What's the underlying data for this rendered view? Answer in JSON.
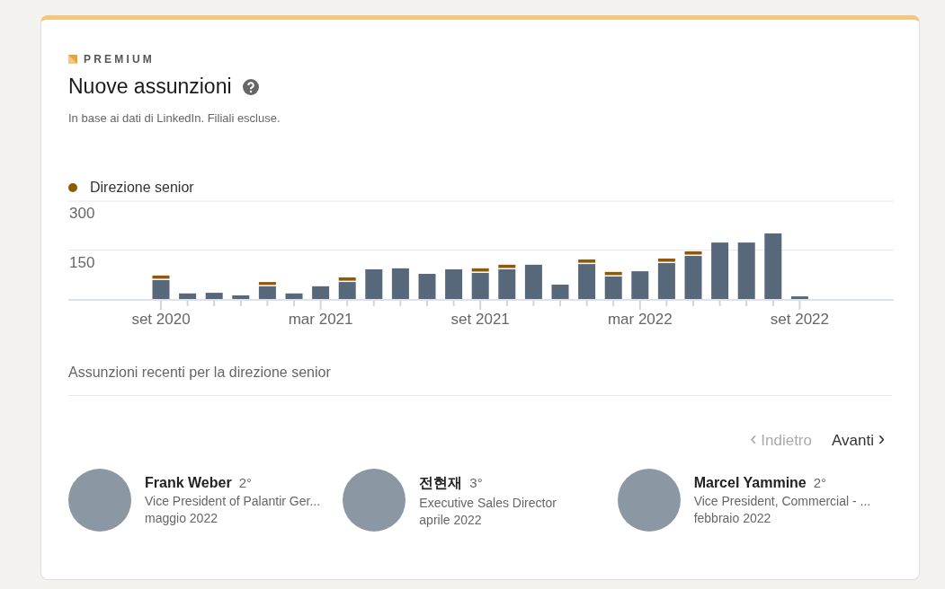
{
  "badge": {
    "label": "PREMIUM"
  },
  "title": "Nuove assunzioni",
  "subtitle": "In base ai dati di LinkedIn. Filiali escluse.",
  "chart_data": {
    "type": "bar",
    "stacked": true,
    "categories": [
      "set 2020",
      null,
      null,
      null,
      null,
      null,
      "mar 2021",
      null,
      null,
      null,
      null,
      null,
      "set 2021",
      null,
      null,
      null,
      null,
      null,
      "mar 2022",
      null,
      null,
      null,
      null,
      null,
      "set 2022"
    ],
    "series": [
      {
        "color": "#56687a",
        "values": [
          58,
          17,
          19,
          11,
          39,
          17,
          39,
          52,
          91,
          94,
          77,
          91,
          80,
          91,
          105,
          44,
          107,
          69,
          85,
          110,
          132,
          173,
          173,
          201,
          8
        ]
      },
      {
        "name": "Direzione senior",
        "color": "#915907",
        "values": [
          14,
          0,
          0,
          0,
          13,
          0,
          0,
          14,
          0,
          0,
          0,
          0,
          14,
          14,
          0,
          0,
          14,
          14,
          0,
          14,
          14,
          0,
          0,
          0,
          0
        ]
      }
    ],
    "ylim": [
      0,
      300
    ],
    "yticks": [
      150,
      300
    ]
  },
  "recent": {
    "heading": "Assunzioni recenti per la direzione senior",
    "prev": {
      "label": "Indietro",
      "disabled": true,
      "icon": "‹"
    },
    "next": {
      "label": "Avanti",
      "disabled": false,
      "icon": "›"
    },
    "people": [
      {
        "name": "Frank Weber",
        "degree": "2°",
        "role": "Vice President of Palantir Ger...",
        "date": "maggio 2022"
      },
      {
        "name": "전현재",
        "degree": "3°",
        "role": "Executive Sales Director",
        "date": "aprile 2022"
      },
      {
        "name": "Marcel Yammine",
        "degree": "2°",
        "role": "Vice President, Commercial - ...",
        "date": "febbraio 2022"
      }
    ]
  }
}
